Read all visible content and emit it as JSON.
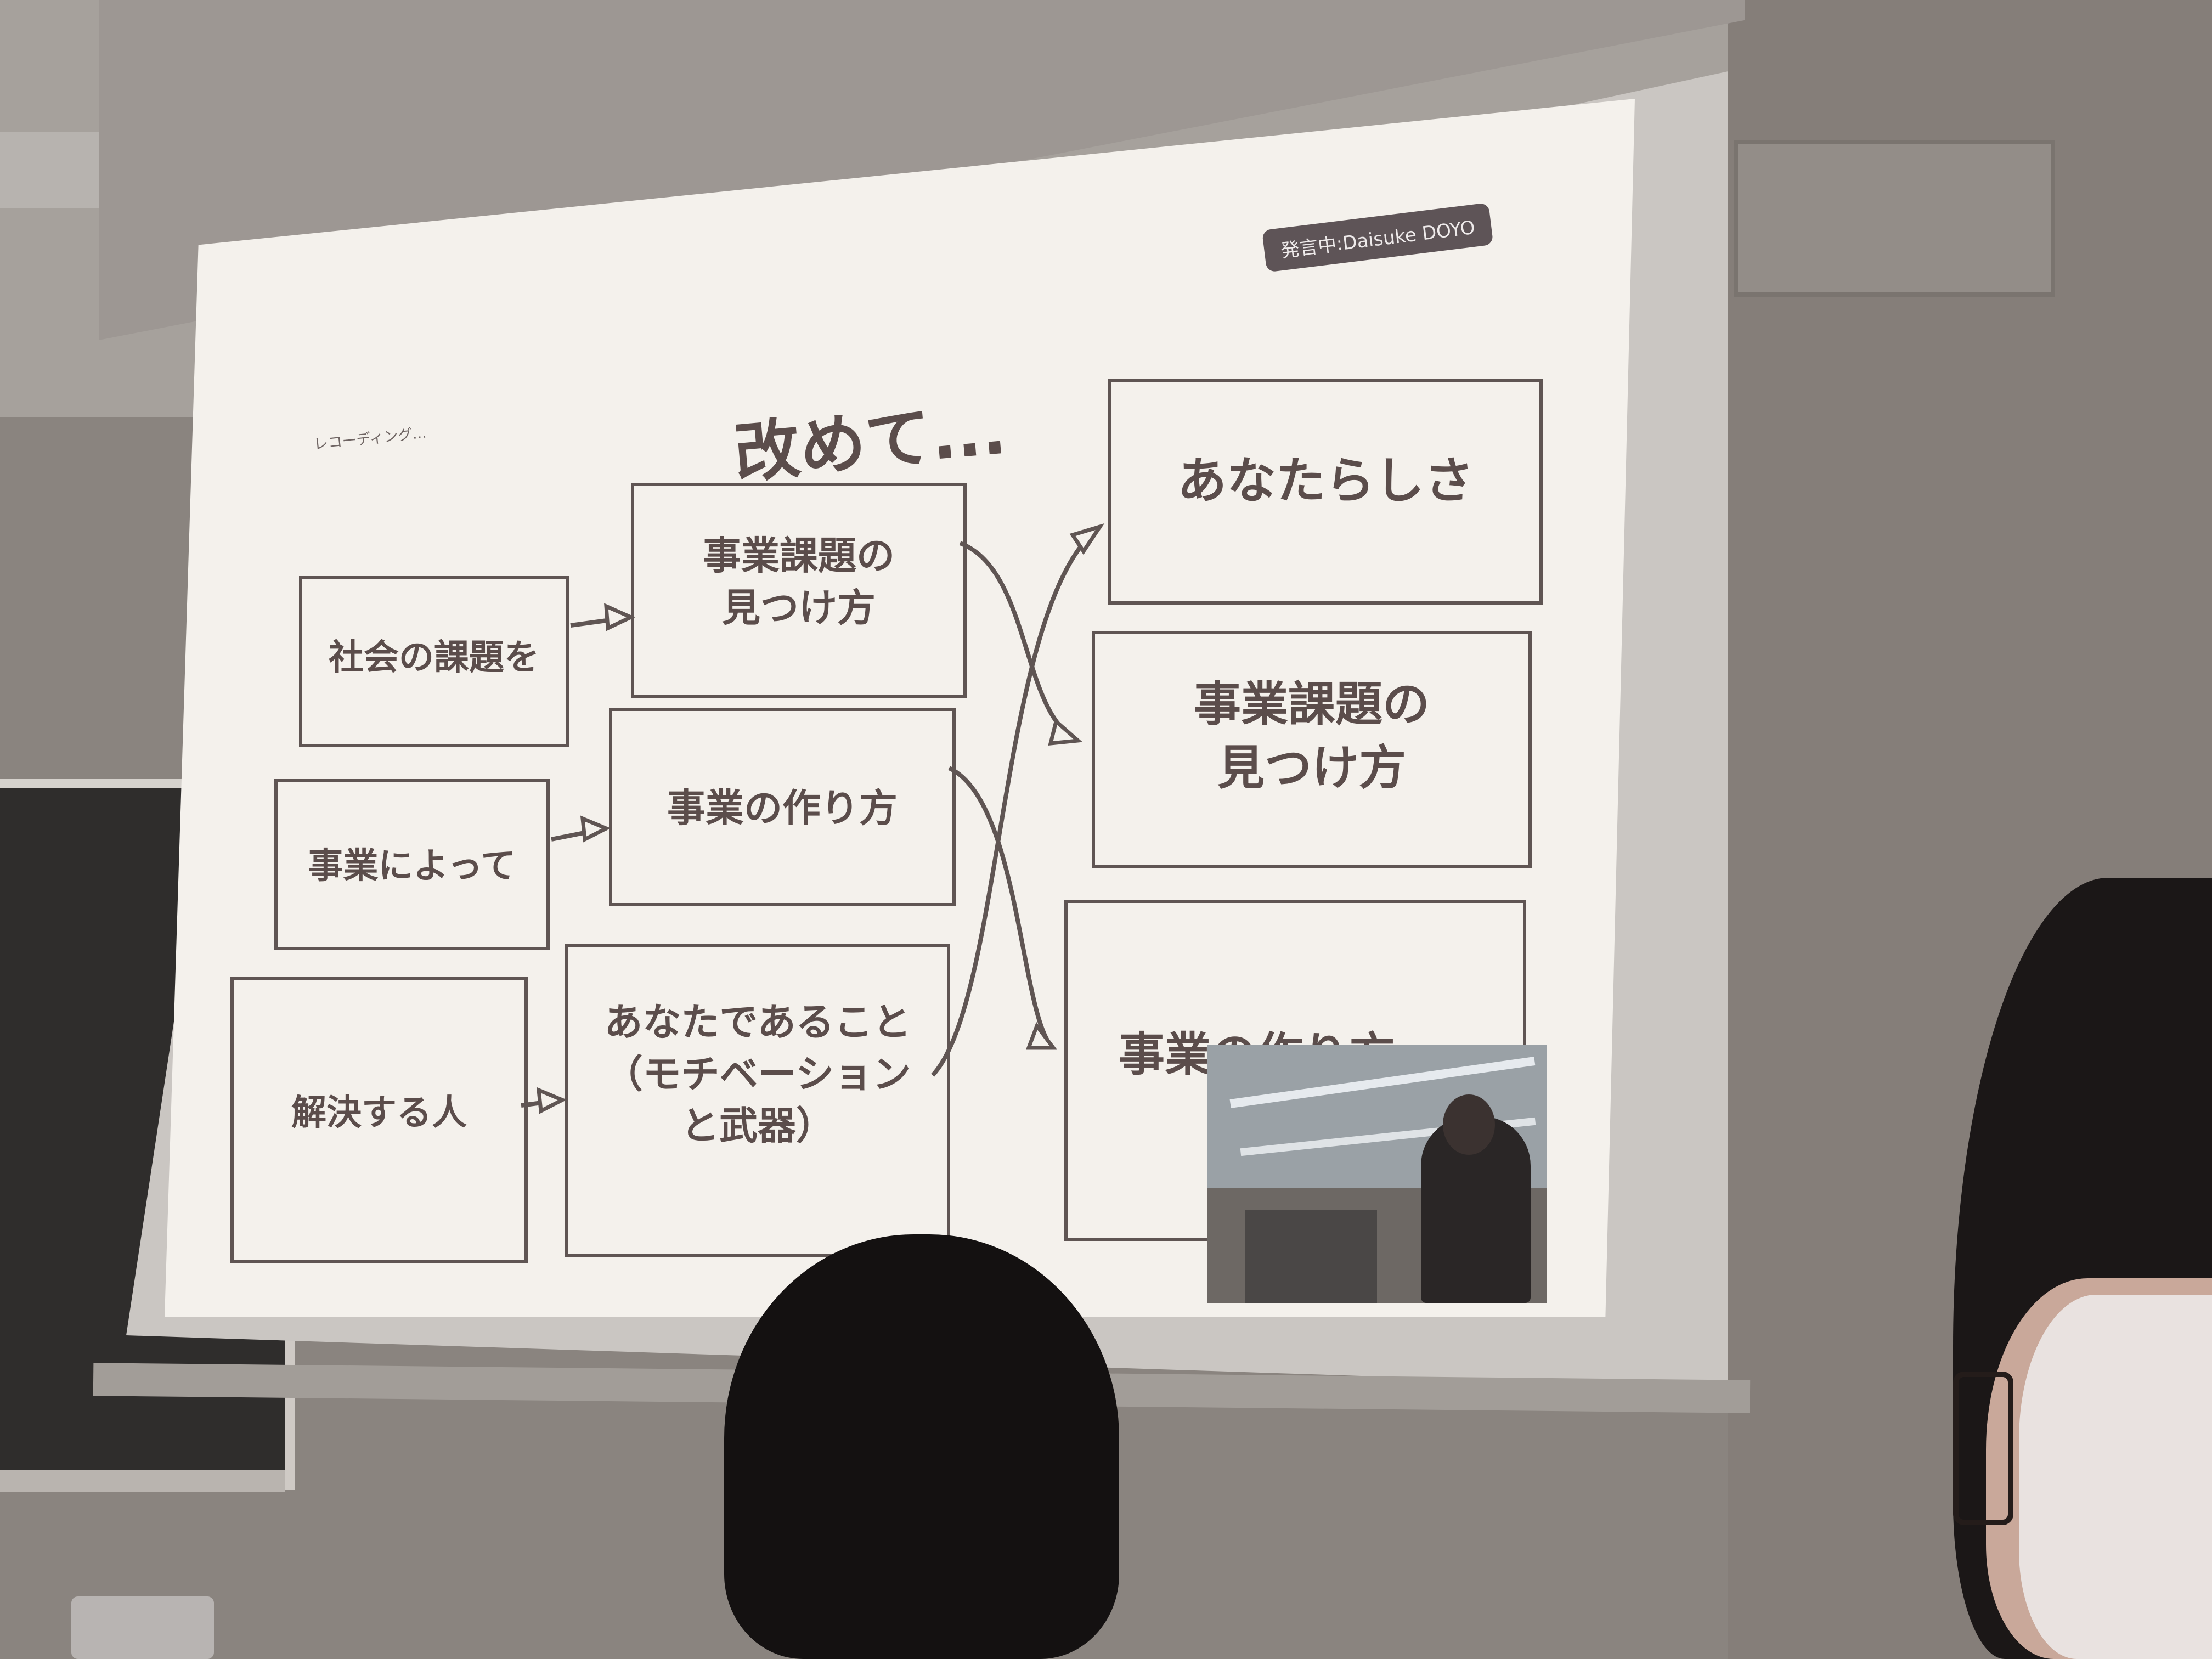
{
  "slide": {
    "badge": "発言中:Daisuke DOYO",
    "brand": "レコーディング…",
    "title": "改めて...",
    "left_column": [
      "社会の課題を",
      "事業によって",
      "解決する人"
    ],
    "middle_column": [
      [
        "事業課題の",
        "見つけ方"
      ],
      [
        "事業の作り方"
      ],
      [
        "あなたであること",
        "（モチベーション",
        "と武器）"
      ]
    ],
    "right_column": [
      [
        "あなたらしさ"
      ],
      [
        "事業課題の",
        "見つけ方"
      ],
      [
        "事業の作り方"
      ]
    ]
  },
  "colors": {
    "slide_background": "#f4f1ec",
    "box_border": "#5f5553",
    "text": "#5b4d4b",
    "badge_background": "#5e5457"
  }
}
